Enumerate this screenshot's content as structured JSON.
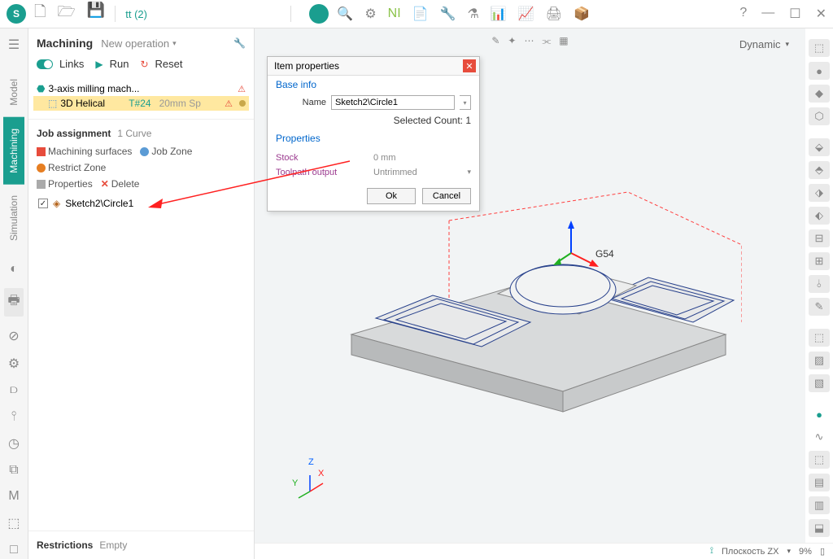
{
  "titlebar": {
    "doc_title": "tt (2)"
  },
  "tabs": {
    "model": "Model",
    "machining": "Machining",
    "simulation": "Simulation"
  },
  "panel": {
    "title": "Machining",
    "new_operation": "New operation",
    "actions": {
      "links": "Links",
      "run": "Run",
      "reset": "Reset"
    },
    "tree": {
      "root": "3-axis milling mach...",
      "op_name": "3D Helical",
      "tool": "T#24",
      "tool_desc": "20mm Sp"
    },
    "job": {
      "title": "Job assignment",
      "subtitle": "1 Curve",
      "buttons": {
        "machining_surfaces": "Machining surfaces",
        "job_zone": "Job Zone",
        "restrict_zone": "Restrict Zone",
        "properties": "Properties",
        "delete": "Delete"
      },
      "curve_item": "Sketch2\\Circle1"
    },
    "restrictions": {
      "title": "Restrictions",
      "value": "Empty"
    }
  },
  "dialog": {
    "title": "Item properties",
    "section_base": "Base info",
    "name_label": "Name",
    "name_value": "Sketch2\\Circle1",
    "selected_count": "Selected Count: 1",
    "section_props": "Properties",
    "stock_label": "Stock",
    "stock_value": "0 mm",
    "toolpath_label": "Toolpath output",
    "toolpath_value": "Untrimmed",
    "ok": "Ok",
    "cancel": "Cancel"
  },
  "viewport": {
    "mode": "Dynamic",
    "coord_label": "G54"
  },
  "statusbar": {
    "plane": "Плоскость ZX",
    "zoom": "9%"
  }
}
